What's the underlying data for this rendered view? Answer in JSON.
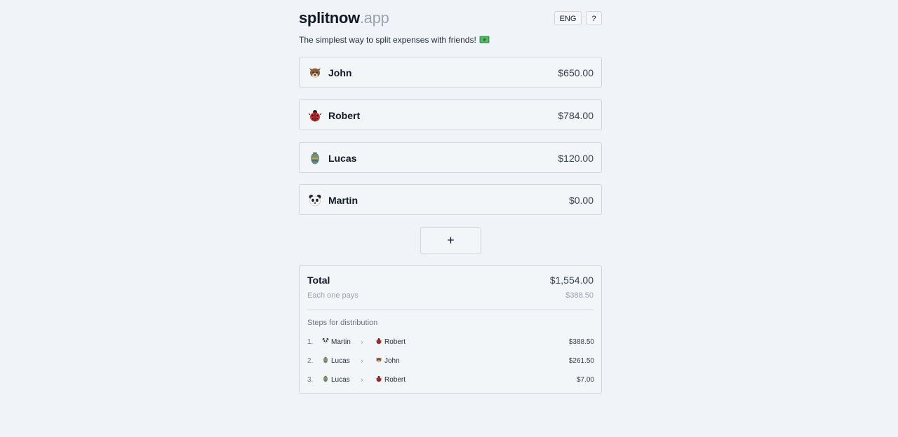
{
  "header": {
    "logo_main": "splitnow",
    "logo_tld": ".app",
    "lang_button": "ENG",
    "help_button": "?"
  },
  "tagline": "The simplest way to split expenses with friends!",
  "people": [
    {
      "name": "John",
      "amount": "$650.00",
      "icon": "wolf-icon"
    },
    {
      "name": "Robert",
      "amount": "$784.00",
      "icon": "ladybug-icon"
    },
    {
      "name": "Lucas",
      "amount": "$120.00",
      "icon": "vase-icon"
    },
    {
      "name": "Martin",
      "amount": "$0.00",
      "icon": "panda-icon"
    }
  ],
  "add_button": "+",
  "summary": {
    "total_label": "Total",
    "total_value": "$1,554.00",
    "each_label": "Each one pays",
    "each_value": "$388.50",
    "steps_title": "Steps for distribution",
    "steps": [
      {
        "num": "1.",
        "from": "Martin",
        "to": "Robert",
        "amount": "$388.50"
      },
      {
        "num": "2.",
        "from": "Lucas",
        "to": "John",
        "amount": "$261.50"
      },
      {
        "num": "3.",
        "from": "Lucas",
        "to": "Robert",
        "amount": "$7.00"
      }
    ]
  },
  "colors": {
    "background": "#f0f4f8",
    "border": "#d1d5db",
    "muted": "#9ca3af"
  }
}
